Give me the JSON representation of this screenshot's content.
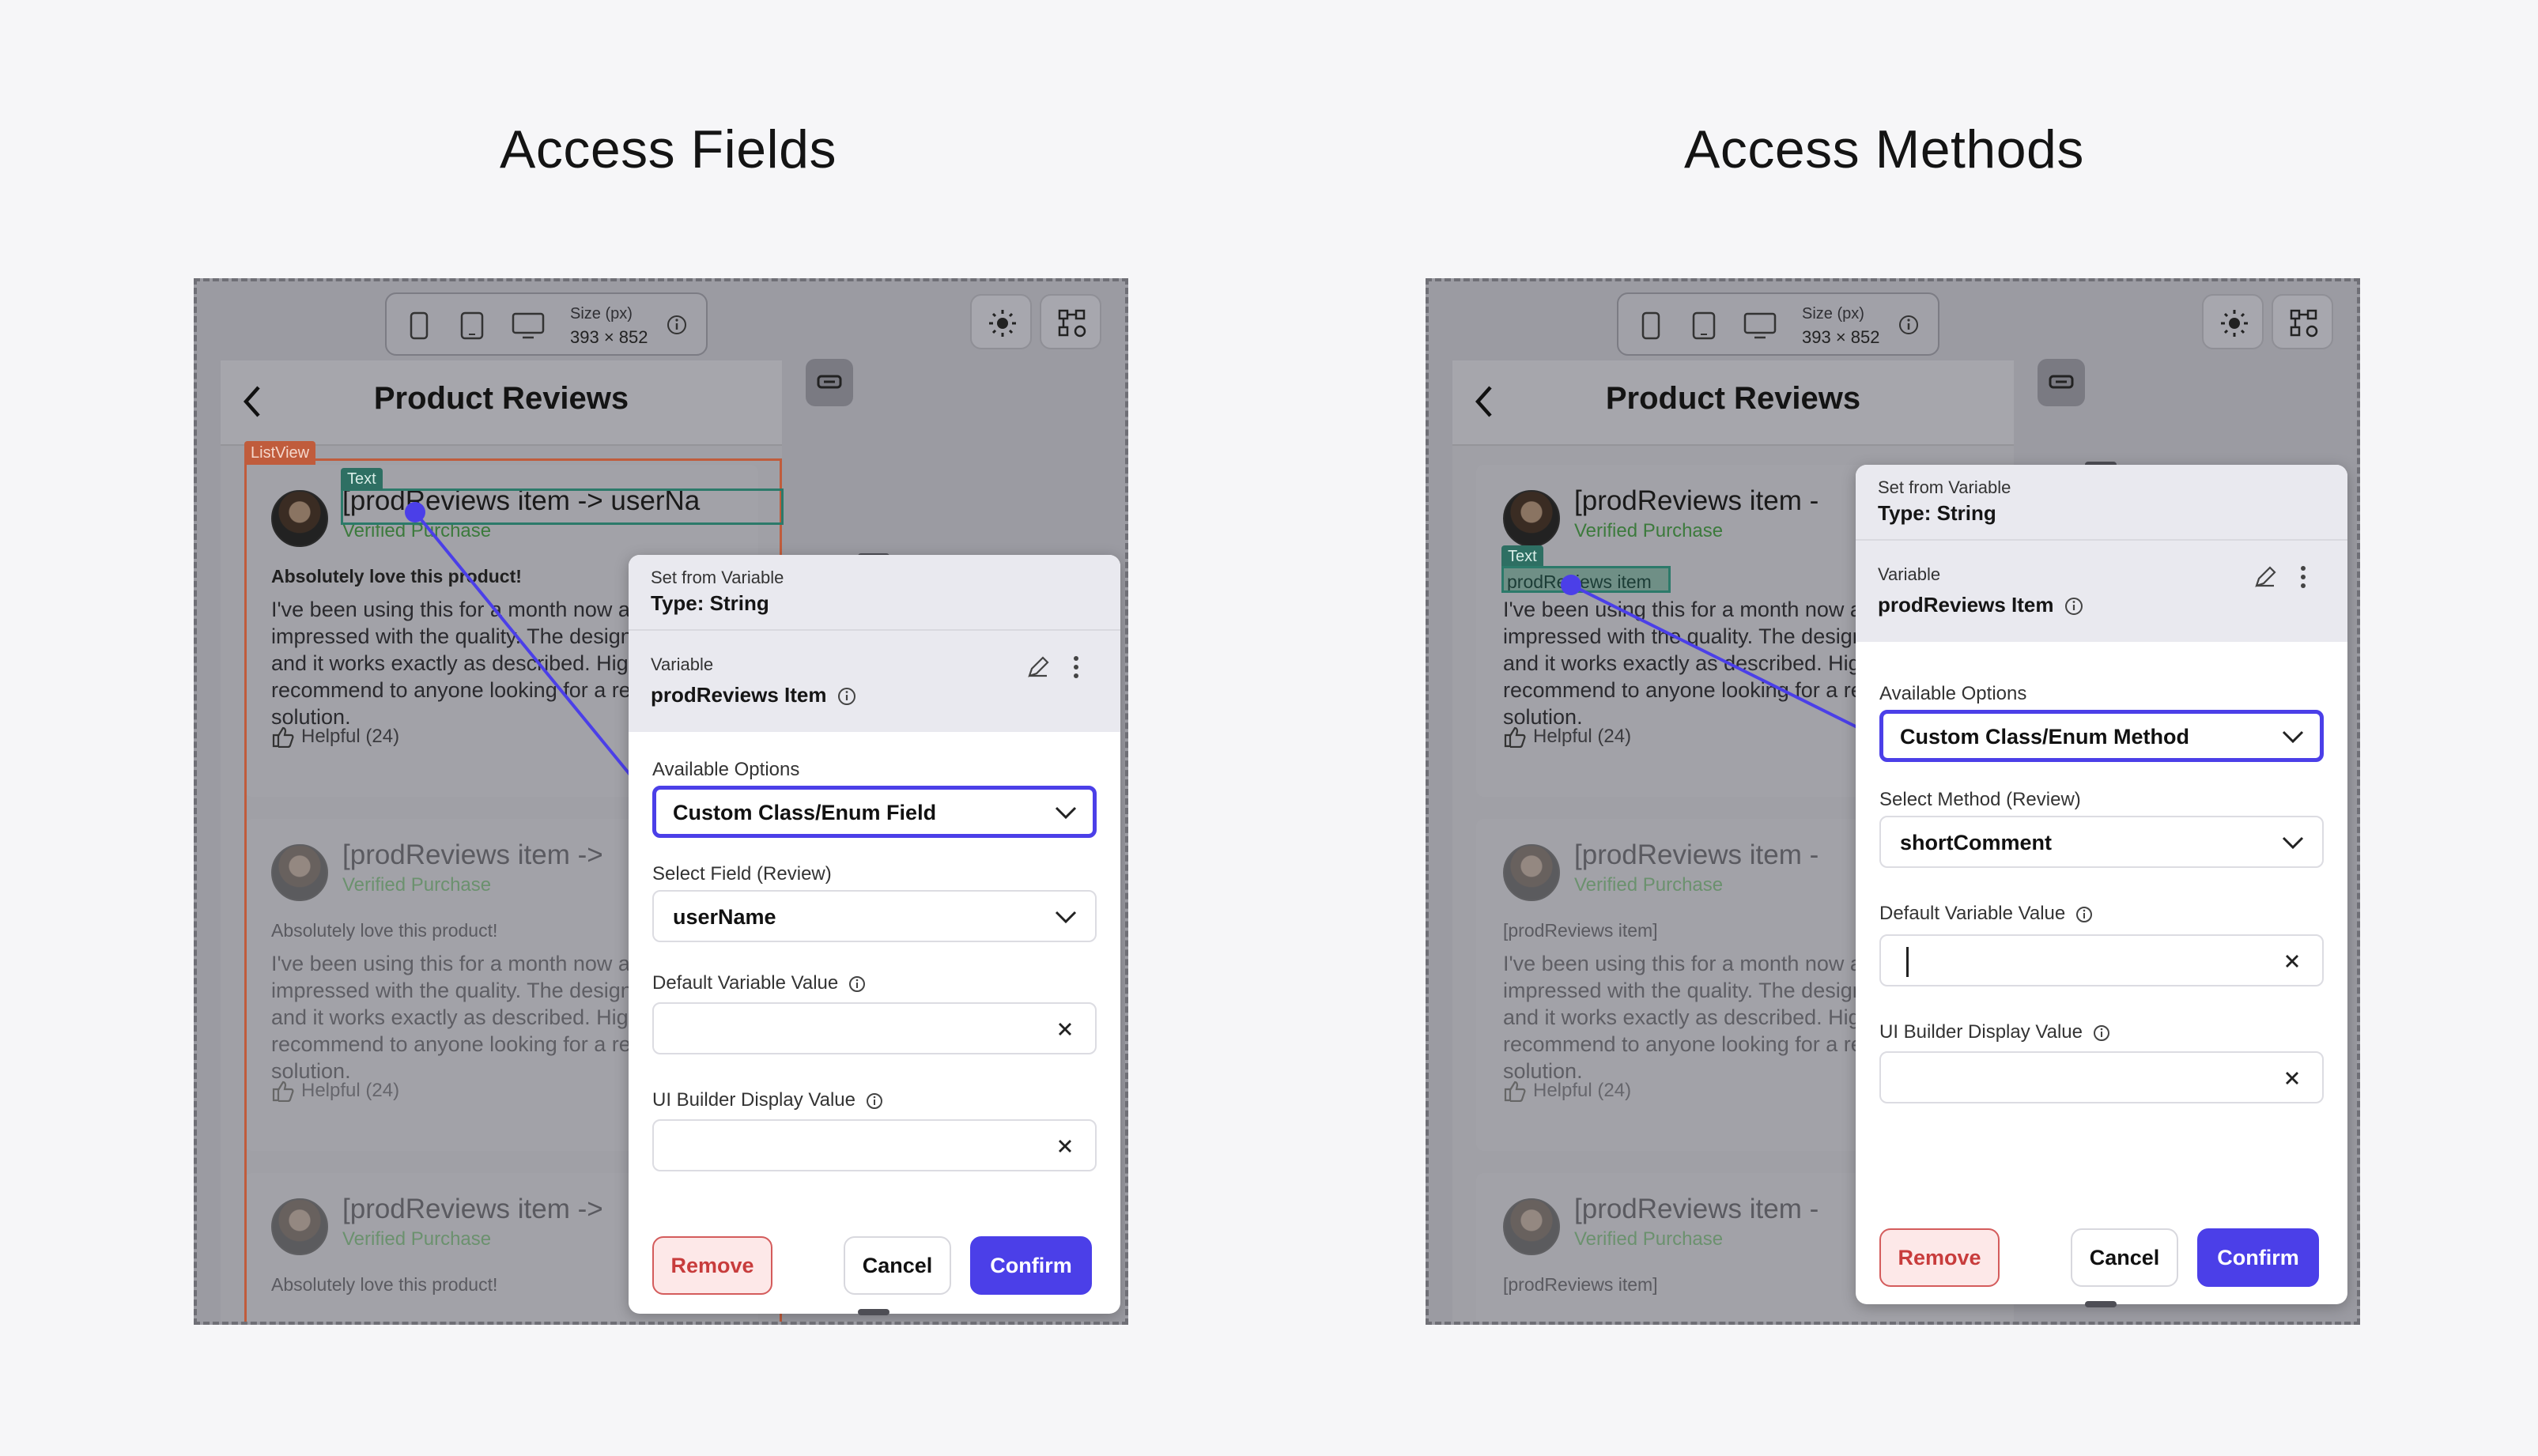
{
  "headings": {
    "left": "Access Fields",
    "right": "Access Methods"
  },
  "colors": {
    "accent": "#4b3fe8",
    "remove": "#c83c3c",
    "listview": "#c05c3c",
    "text_widget": "#2c7a6a"
  },
  "toolbar": {
    "size_label": "Size (px)",
    "size_value": "393 × 852"
  },
  "app": {
    "title": "Product Reviews"
  },
  "tags": {
    "listview": "ListView",
    "text": "Text"
  },
  "review": {
    "title_full": "[prodReviews item -> userNa",
    "title_short": "[prodReviews item ->",
    "title_shorter": "[prodReviews item -",
    "verified": "Verified Purchase",
    "head": "Absolutely love this product!",
    "head_var": "[prodReviews item]",
    "body": "I've been using this for a month now and I'm impressed with the quality. The design is sleek and it works exactly as described. Highly recommend to anyone looking for a reliable solution.",
    "helpful": "Helpful (24)",
    "text_highlight": "prodReviews item"
  },
  "panel": {
    "set_from": "Set from Variable",
    "type": "Type: String",
    "variable_label": "Variable",
    "variable_value": "prodReviews Item",
    "available_options": "Available Options",
    "default_label": "Default Variable Value",
    "display_label": "UI Builder Display Value",
    "remove": "Remove",
    "cancel": "Cancel",
    "confirm": "Confirm"
  },
  "left_panel": {
    "option": "Custom Class/Enum Field",
    "select_label": "Select Field (Review)",
    "select_value": "userName"
  },
  "right_panel": {
    "option": "Custom Class/Enum Method",
    "select_label": "Select Method (Review)",
    "select_value": "shortComment"
  }
}
